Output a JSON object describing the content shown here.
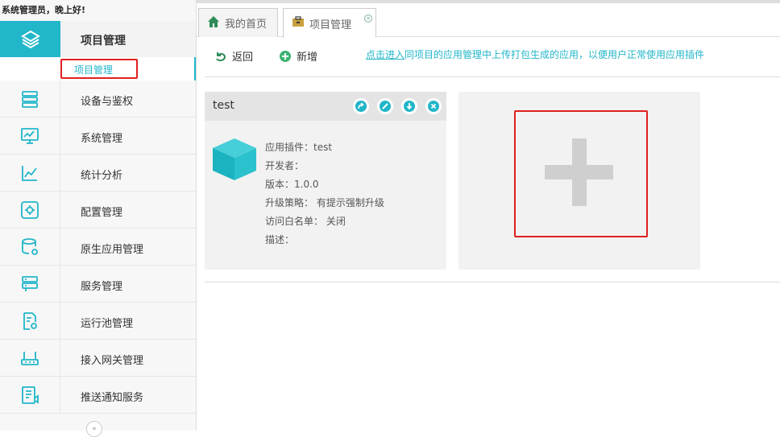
{
  "sidebar": {
    "greeting": "系统管理员，晚上好!",
    "active_item": "项目管理",
    "sub_item": "项目管理",
    "items": [
      {
        "label": "设备与鉴权",
        "icon": "server-icon"
      },
      {
        "label": "系统管理",
        "icon": "monitor-chart-icon"
      },
      {
        "label": "统计分析",
        "icon": "line-chart-icon"
      },
      {
        "label": "配置管理",
        "icon": "gear-box-icon"
      },
      {
        "label": "原生应用管理",
        "icon": "database-gear-icon"
      },
      {
        "label": "服务管理",
        "icon": "server-stack-icon"
      },
      {
        "label": "运行池管理",
        "icon": "document-gear-icon"
      },
      {
        "label": "接入网关管理",
        "icon": "router-icon"
      },
      {
        "label": "推送通知服务",
        "icon": "notice-icon"
      }
    ]
  },
  "tabs": [
    {
      "label": "我的首页",
      "icon": "home-icon"
    },
    {
      "label": "项目管理",
      "icon": "briefcase-icon"
    }
  ],
  "toolbar": {
    "back_label": "返回",
    "new_label": "新增",
    "hint_link": "点击进入",
    "hint_text": "同项目的应用管理中上传打包生成的应用，以便用户正常使用应用插件"
  },
  "card": {
    "title": "test",
    "info": [
      "应用插件：test",
      "开发者：",
      "版本：1.0.0",
      "升级策略： 有提示强制升级",
      "访问白名单： 关闭",
      "描述："
    ]
  },
  "colors": {
    "accent": "#21b6c9",
    "highlight": "#e02020"
  }
}
